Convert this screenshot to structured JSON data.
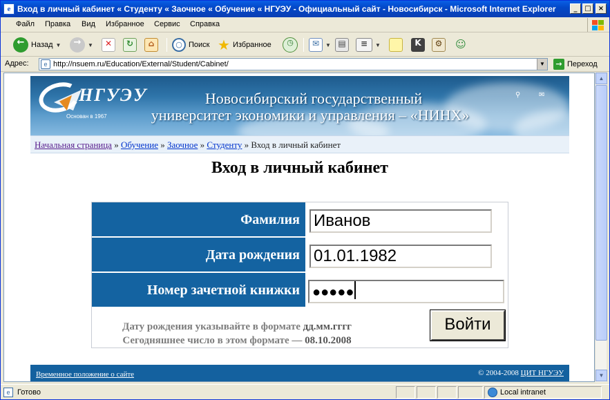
{
  "window": {
    "title": "Вход в личный кабинет « Студенту « Заочное « Обучение « НГУЭУ - Официальный сайт - Новосибирск - Microsoft Internet Explorer",
    "min_glyph": "_",
    "max_glyph": "□",
    "close_glyph": "×"
  },
  "menu": [
    "Файл",
    "Правка",
    "Вид",
    "Избранное",
    "Сервис",
    "Справка"
  ],
  "toolbar": {
    "back_label": "Назад",
    "search_label": "Поиск",
    "favorites_label": "Избранное"
  },
  "address": {
    "label": "Адрес:",
    "url": "http://nsuem.ru/Education/External/Student/Cabinet/",
    "go_label": "Переход"
  },
  "site": {
    "logo_text": "НГУЭУ",
    "logo_since": "Основан в 1967",
    "banner_line1": "Новосибирский государственный",
    "banner_line2": "университет экономики и управления – «НИНХ»"
  },
  "breadcrumb": {
    "items": [
      "Начальная страница",
      "Обучение",
      "Заочное",
      "Студенту"
    ],
    "separator": "»",
    "current": "Вход в личный кабинет"
  },
  "login": {
    "heading": "Вход в личный кабинет",
    "surname_label": "Фамилия",
    "surname_value": "Иванов",
    "birthdate_label": "Дата рождения",
    "birthdate_value": "01.01.1982",
    "record_book_label": "Номер зачетной книжки",
    "record_book_value": "●●●●●",
    "hint_line1_text": "Дату рождения указывайте в формате ",
    "hint_line1_format": "дд.мм.гггг",
    "hint_line2_text": "Сегодняшнее число в этом формате — ",
    "hint_line2_date": "08.10.2008",
    "submit_label": "Войти"
  },
  "footer": {
    "left_link": "Временное положение о сайте",
    "copyright": "© 2004-2008 ",
    "copyright_link": "ЦИТ НГУЭУ"
  },
  "status": {
    "text": "Готово",
    "zone": "Local intranet"
  },
  "colors": {
    "label_bg": "#1463a1",
    "footer_bg": "#14619f",
    "titlebar": "#0348c8"
  }
}
